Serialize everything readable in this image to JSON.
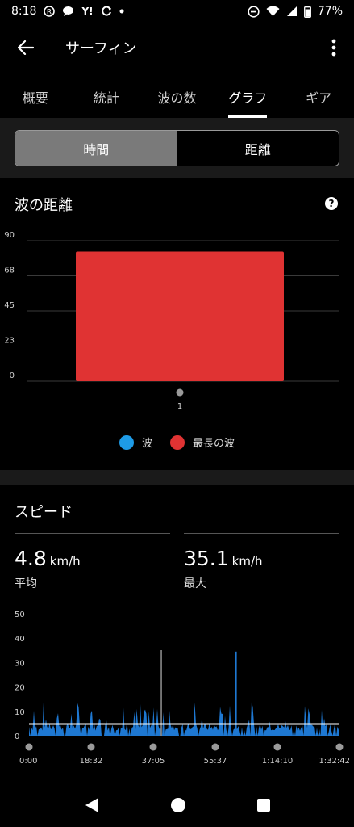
{
  "status": {
    "time": "8:18",
    "battery": "77%"
  },
  "app_bar": {
    "title": "サーフィン"
  },
  "tabs": [
    "概要",
    "統計",
    "波の数",
    "グラフ",
    "ギア"
  ],
  "active_tab": 3,
  "segmented": {
    "options": [
      "時間",
      "距離"
    ],
    "active": 0
  },
  "wave_chart": {
    "title": "波の距離",
    "legend": [
      {
        "label": "波",
        "color": "#1e9be6"
      },
      {
        "label": "最長の波",
        "color": "#e03333"
      }
    ]
  },
  "speed": {
    "title": "スピード",
    "avg": {
      "value": "4.8",
      "unit": "km/h",
      "label": "平均"
    },
    "max": {
      "value": "35.1",
      "unit": "km/h",
      "label": "最大"
    }
  },
  "colors": {
    "bar_red": "#e03333",
    "speed_blue": "#1e78d2",
    "band": "#1a1a1a"
  },
  "chart_data": [
    {
      "type": "bar",
      "title": "波の距離",
      "categories": [
        "1"
      ],
      "series": [
        {
          "name": "最長の波",
          "values": [
            83
          ]
        }
      ],
      "ylim": [
        0,
        90
      ],
      "yticks": [
        "90",
        "68",
        "45",
        "23",
        "0"
      ],
      "grid": true,
      "legend": "bottom"
    },
    {
      "type": "area",
      "title": "スピード",
      "x_ticks": [
        "0:00",
        "18:32",
        "37:05",
        "55:37",
        "1:14:10",
        "1:32:42"
      ],
      "yticks": [
        "50",
        "40",
        "30",
        "20",
        "10",
        "0"
      ],
      "ylim": [
        0,
        50
      ],
      "duration_seconds": 5562,
      "average": 4.8,
      "spikes": [
        {
          "t": 2370,
          "v": 35.1
        },
        {
          "t": 3710,
          "v": 34.5
        }
      ],
      "grid": false
    }
  ]
}
